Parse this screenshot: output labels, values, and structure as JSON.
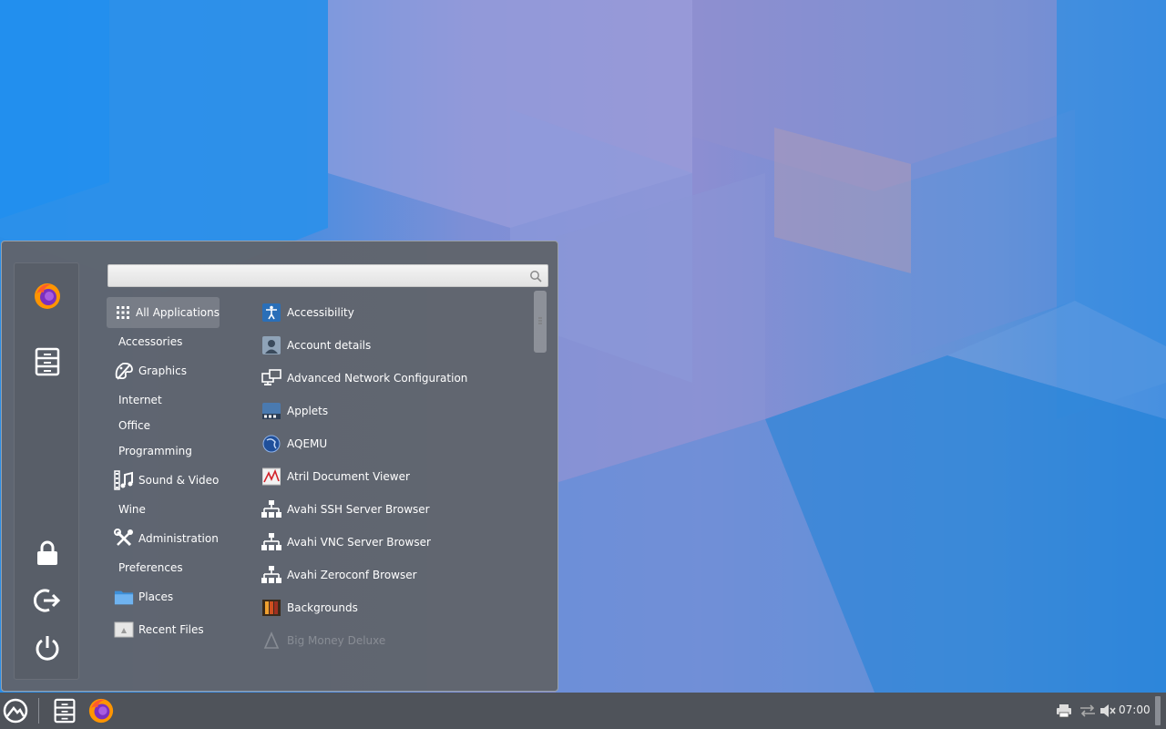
{
  "search": {
    "value": "",
    "placeholder": ""
  },
  "favorites": [
    {
      "icon": "firefox-icon"
    },
    {
      "icon": "file-manager-icon"
    }
  ],
  "session": [
    {
      "icon": "lock-icon"
    },
    {
      "icon": "logout-icon"
    },
    {
      "icon": "power-icon"
    }
  ],
  "categories": [
    {
      "label": "All Applications",
      "icon": "grid-icon",
      "selected": true
    },
    {
      "label": "Accessories"
    },
    {
      "label": "Graphics",
      "icon": "graphics-icon"
    },
    {
      "label": "Internet"
    },
    {
      "label": "Office"
    },
    {
      "label": "Programming"
    },
    {
      "label": "Sound & Video",
      "icon": "sound-video-icon"
    },
    {
      "label": "Wine"
    },
    {
      "label": "Administration",
      "icon": "administration-icon"
    },
    {
      "label": "Preferences"
    },
    {
      "label": "Places",
      "icon": "folder-icon"
    },
    {
      "label": "Recent Files",
      "icon": "recent-files-icon"
    }
  ],
  "apps": [
    {
      "label": "Accessibility",
      "icon": "accessibility-icon"
    },
    {
      "label": "Account details",
      "icon": "account-icon"
    },
    {
      "label": "Advanced Network Configuration",
      "icon": "network-icon"
    },
    {
      "label": "Applets",
      "icon": "applets-icon"
    },
    {
      "label": "AQEMU",
      "icon": "aqemu-icon"
    },
    {
      "label": "Atril Document Viewer",
      "icon": "document-viewer-icon"
    },
    {
      "label": "Avahi SSH Server Browser",
      "icon": "avahi-icon"
    },
    {
      "label": "Avahi VNC Server Browser",
      "icon": "avahi-icon"
    },
    {
      "label": "Avahi Zeroconf Browser",
      "icon": "avahi-icon"
    },
    {
      "label": "Backgrounds",
      "icon": "backgrounds-icon"
    },
    {
      "label": "Big Money Deluxe",
      "icon": "game-icon",
      "faded": true
    }
  ],
  "taskbar": {
    "clock": "07:00",
    "tray": [
      "printer-icon",
      "network-icon",
      "volume-muted-icon"
    ]
  }
}
